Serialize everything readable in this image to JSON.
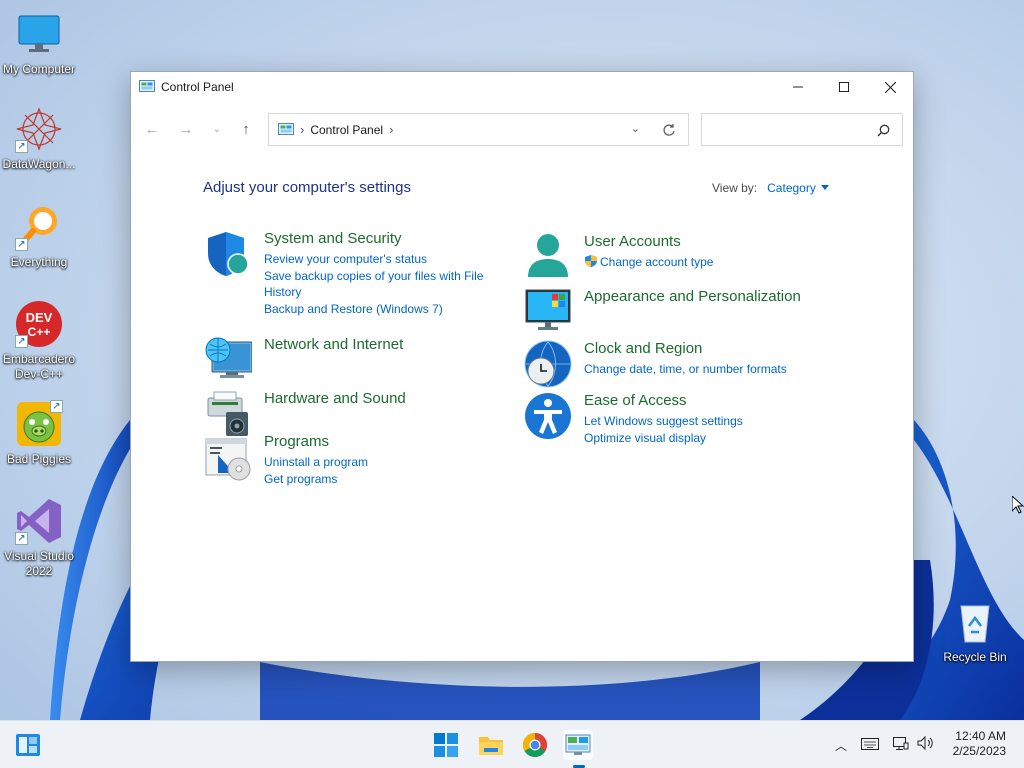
{
  "desktop": {
    "icons": [
      {
        "name": "my-computer",
        "label": "My Computer"
      },
      {
        "name": "datawagon",
        "label": "DataWagon..."
      },
      {
        "name": "everything",
        "label": "Everything"
      },
      {
        "name": "devcpp",
        "label": "Embarcadero Dev-C++",
        "badge": "DEV C++"
      },
      {
        "name": "bad-piggies",
        "label": "Bad Piggies"
      },
      {
        "name": "visual-studio",
        "label": "Visual Studio 2022"
      },
      {
        "name": "recycle-bin",
        "label": "Recycle Bin"
      }
    ]
  },
  "window": {
    "title": "Control Panel",
    "address": {
      "crumb": "Control Panel",
      "sep": "›"
    },
    "search": {
      "placeholder": ""
    },
    "heading": "Adjust your computer's settings",
    "view_by": {
      "label": "View by:",
      "value": "Category"
    },
    "categories": [
      {
        "title": "System and Security",
        "links": [
          "Review your computer's status",
          "Save backup copies of your files with File History",
          "Backup and Restore (Windows 7)"
        ]
      },
      {
        "title": "Network and Internet",
        "links": []
      },
      {
        "title": "Hardware and Sound",
        "links": []
      },
      {
        "title": "Programs",
        "links": [
          "Uninstall a program",
          "Get programs"
        ]
      },
      {
        "title": "User Accounts",
        "links": [
          "Change account type"
        ]
      },
      {
        "title": "Appearance and Personalization",
        "links": []
      },
      {
        "title": "Clock and Region",
        "links": [
          "Change date, time, or number formats"
        ]
      },
      {
        "title": "Ease of Access",
        "links": [
          "Let Windows suggest settings",
          "Optimize visual display"
        ]
      }
    ]
  },
  "taskbar": {
    "clock": {
      "time": "12:40 AM",
      "date": "2/25/2023"
    }
  },
  "colors": {
    "accent": "#0067c0",
    "link": "#0066cc",
    "category_title": "#1c6b2e",
    "heading": "#1e3287"
  }
}
